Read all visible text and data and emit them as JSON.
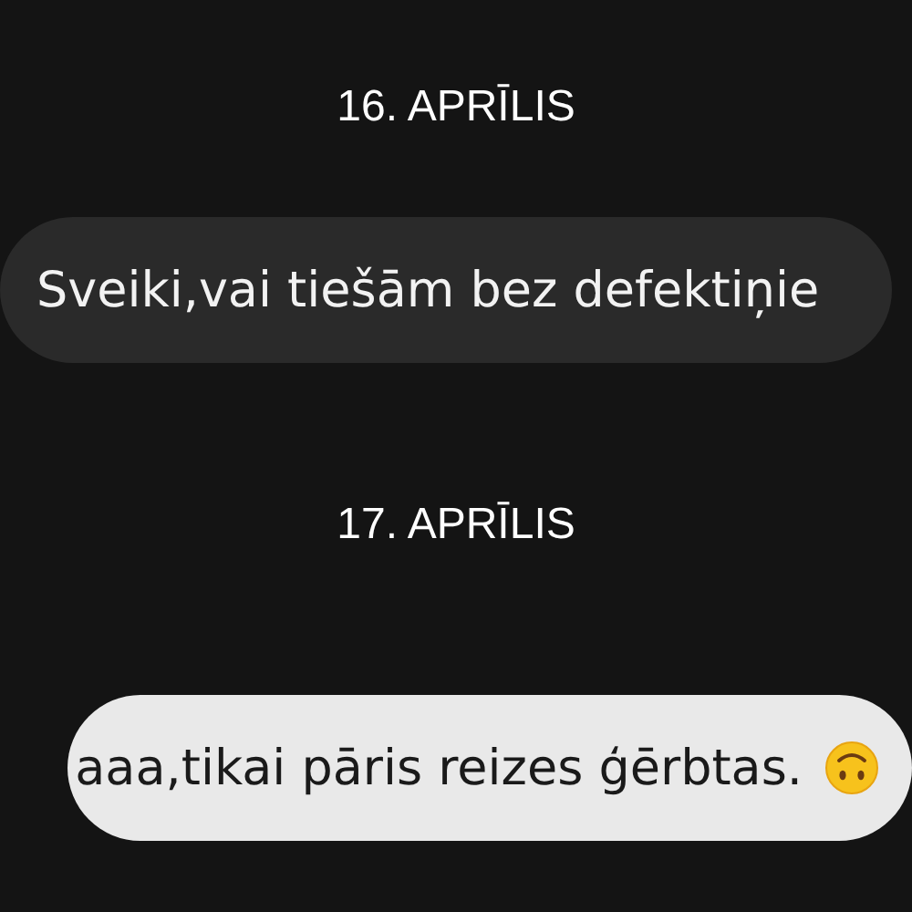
{
  "messages": [
    {
      "kind": "date",
      "text": "16. APRĪLIS"
    },
    {
      "kind": "incoming",
      "text": "Sveiki,vai tiešām bez defektiņie"
    },
    {
      "kind": "date",
      "text": "17. APRĪLIS"
    },
    {
      "kind": "outgoing",
      "text": "aaa,tikai pāris reizes ģērbtas.",
      "emoji": true
    }
  ]
}
